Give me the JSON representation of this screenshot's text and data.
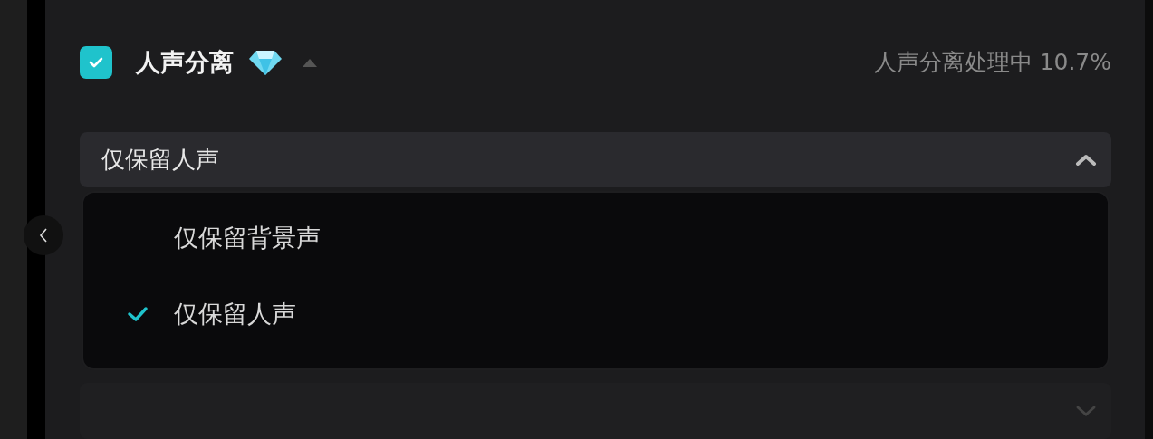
{
  "section": {
    "title": "人声分离",
    "checked": true,
    "expanded": true,
    "status": "人声分离处理中 10.7%"
  },
  "select": {
    "value": "仅保留人声",
    "open": true
  },
  "options": [
    {
      "label": "仅保留背景声",
      "selected": false
    },
    {
      "label": "仅保留人声",
      "selected": true
    }
  ]
}
